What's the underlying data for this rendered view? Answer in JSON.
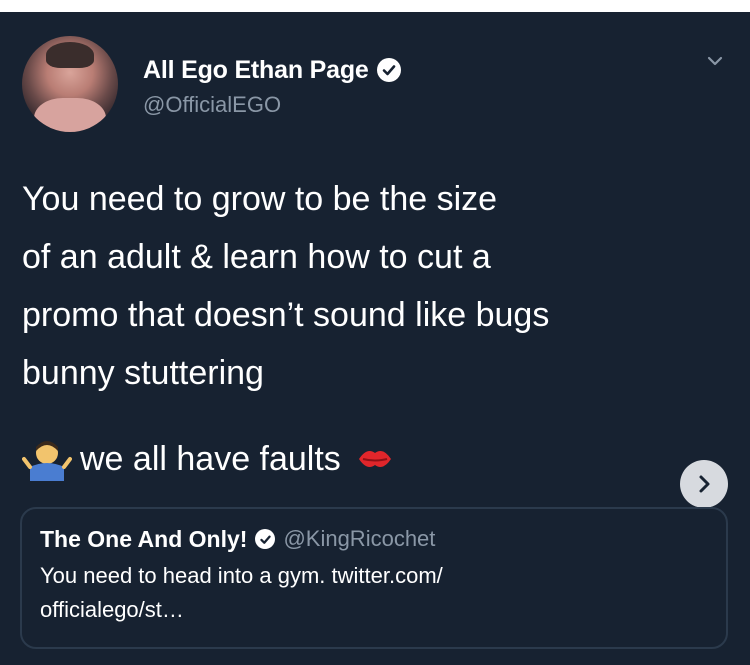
{
  "author": {
    "display_name": "All Ego Ethan Page",
    "handle": "@OfficialEGO"
  },
  "tweet": {
    "lines": [
      "You need to grow to be the size",
      "of an adult & learn how to cut a",
      "promo that doesn’t sound like bugs",
      "bunny stuttering"
    ],
    "faults_text": "we all have faults"
  },
  "quoted_tweet": {
    "display_name": "The One And Only!",
    "handle": "@KingRicochet",
    "text_line1": "You need to head into a gym. twitter.com/",
    "text_line2": "officialego/st…"
  },
  "icons": {
    "verified": "verified-badge-icon",
    "menu": "chevron-down-icon",
    "next": "chevron-right-icon",
    "emoji_1": "person-shrugging-emoji",
    "emoji_2": "kiss-mark-emoji"
  },
  "colors": {
    "background": "#172231",
    "text": "#ffffff",
    "secondary_text": "#8a97a6",
    "quote_border": "#2b3a4c"
  }
}
